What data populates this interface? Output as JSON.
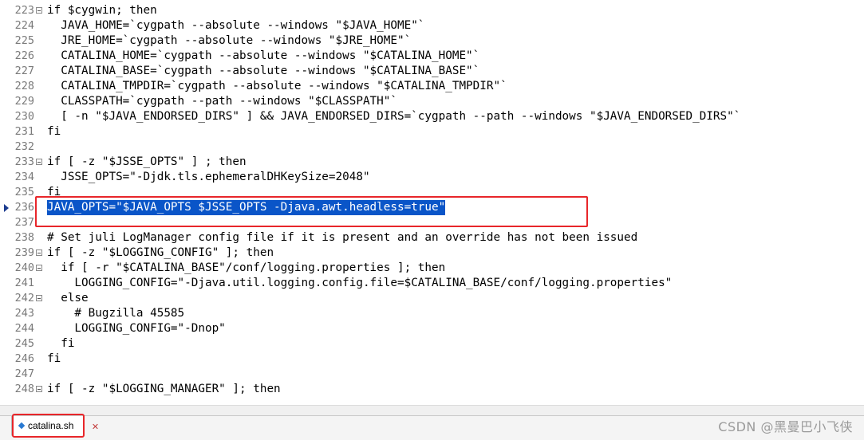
{
  "editor": {
    "lines": [
      {
        "num": "223",
        "fold": true,
        "text": "if $cygwin; then"
      },
      {
        "num": "224",
        "fold": false,
        "text": "  JAVA_HOME=`cygpath --absolute --windows \"$JAVA_HOME\"`"
      },
      {
        "num": "225",
        "fold": false,
        "text": "  JRE_HOME=`cygpath --absolute --windows \"$JRE_HOME\"`"
      },
      {
        "num": "226",
        "fold": false,
        "text": "  CATALINA_HOME=`cygpath --absolute --windows \"$CATALINA_HOME\"`"
      },
      {
        "num": "227",
        "fold": false,
        "text": "  CATALINA_BASE=`cygpath --absolute --windows \"$CATALINA_BASE\"`"
      },
      {
        "num": "228",
        "fold": false,
        "text": "  CATALINA_TMPDIR=`cygpath --absolute --windows \"$CATALINA_TMPDIR\"`"
      },
      {
        "num": "229",
        "fold": false,
        "text": "  CLASSPATH=`cygpath --path --windows \"$CLASSPATH\"`"
      },
      {
        "num": "230",
        "fold": false,
        "text": "  [ -n \"$JAVA_ENDORSED_DIRS\" ] && JAVA_ENDORSED_DIRS=`cygpath --path --windows \"$JAVA_ENDORSED_DIRS\"`"
      },
      {
        "num": "231",
        "fold": false,
        "text": "fi"
      },
      {
        "num": "232",
        "fold": false,
        "text": ""
      },
      {
        "num": "233",
        "fold": true,
        "text": "if [ -z \"$JSSE_OPTS\" ] ; then"
      },
      {
        "num": "234",
        "fold": false,
        "text": "  JSSE_OPTS=\"-Djdk.tls.ephemeralDHKeySize=2048\""
      },
      {
        "num": "235",
        "fold": false,
        "text": "fi"
      },
      {
        "num": "236",
        "fold": false,
        "text": "JAVA_OPTS=\"$JAVA_OPTS $JSSE_OPTS -Djava.awt.headless=true\"",
        "selected": true,
        "bookmark": true
      },
      {
        "num": "237",
        "fold": false,
        "text": ""
      },
      {
        "num": "238",
        "fold": false,
        "text": "# Set juli LogManager config file if it is present and an override has not been issued"
      },
      {
        "num": "239",
        "fold": true,
        "text": "if [ -z \"$LOGGING_CONFIG\" ]; then"
      },
      {
        "num": "240",
        "fold": true,
        "text": "  if [ -r \"$CATALINA_BASE\"/conf/logging.properties ]; then"
      },
      {
        "num": "241",
        "fold": false,
        "text": "    LOGGING_CONFIG=\"-Djava.util.logging.config.file=$CATALINA_BASE/conf/logging.properties\""
      },
      {
        "num": "242",
        "fold": true,
        "text": "  else"
      },
      {
        "num": "243",
        "fold": false,
        "text": "    # Bugzilla 45585"
      },
      {
        "num": "244",
        "fold": false,
        "text": "    LOGGING_CONFIG=\"-Dnop\""
      },
      {
        "num": "245",
        "fold": false,
        "text": "  fi"
      },
      {
        "num": "246",
        "fold": false,
        "text": "fi"
      },
      {
        "num": "247",
        "fold": false,
        "text": ""
      },
      {
        "num": "248",
        "fold": true,
        "text": "if [ -z \"$LOGGING_MANAGER\" ]; then"
      }
    ]
  },
  "tabbar": {
    "active_tab": {
      "label": "catalina.sh",
      "icon": "file-modified-icon"
    },
    "close_icon": "close-icon"
  },
  "watermark": "CSDN @黑曼巴小飞侠",
  "colors": {
    "selection": "#0a55c8",
    "annotation_box": "#e8262a",
    "line_number": "#7a7a7a"
  }
}
